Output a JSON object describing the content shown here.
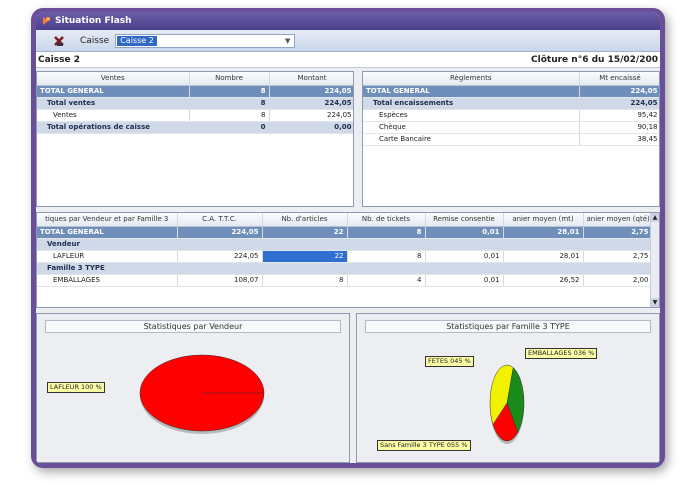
{
  "window": {
    "title": "Situation Flash"
  },
  "toolbar": {
    "caisse_label": "Caisse",
    "caisse_value": "Caisse 2"
  },
  "info": {
    "left": "Caisse 2",
    "right": "Clôture n°6 du 15/02/200"
  },
  "ventes": {
    "headers": [
      "Ventes",
      "Nombre",
      "Montant"
    ],
    "rows": [
      {
        "label": "TOTAL GENERAL",
        "nombre": "8",
        "montant": "224,05"
      },
      {
        "label": "Total ventes",
        "nombre": "8",
        "montant": "224,05"
      },
      {
        "label": "Ventes",
        "nombre": "8",
        "montant": "224,05"
      },
      {
        "label": "Total opérations de caisse",
        "nombre": "0",
        "montant": "0,00"
      }
    ]
  },
  "reglements": {
    "headers": [
      "Règlements",
      "Mt encaissé"
    ],
    "rows": [
      {
        "label": "TOTAL GENERAL",
        "montant": "224,05"
      },
      {
        "label": "Total encaissements",
        "montant": "224,05"
      },
      {
        "label": "Espèces",
        "montant": "95,42"
      },
      {
        "label": "Chèque",
        "montant": "90,18"
      },
      {
        "label": "Carte Bancaire",
        "montant": "38,45"
      }
    ]
  },
  "stats": {
    "headers": [
      "tiques par Vendeur et par Famille 3",
      "C.A. T.T.C.",
      "Nb. d'articles",
      "Nb. de tickets",
      "Remise consentie",
      "anier moyen (mt)",
      "anier moyen (qté)"
    ],
    "total": [
      "TOTAL GENERAL",
      "224,05",
      "22",
      "8",
      "0,01",
      "28,01",
      "2,75"
    ],
    "group1": "Vendeur",
    "row1": [
      "LAFLEUR",
      "224,05",
      "22",
      "8",
      "0,01",
      "28,01",
      "2,75"
    ],
    "group2": "Famille 3 TYPE",
    "row2": [
      "EMBALLAGES",
      "108,07",
      "8",
      "4",
      "0,01",
      "26,52",
      "2,00"
    ]
  },
  "chart_vendeur": {
    "title": "Statistiques par Vendeur",
    "label": "LAFLEUR 100 %"
  },
  "chart_famille": {
    "title": "Statistiques par Famille 3 TYPE",
    "labels": [
      "FETES 045 %",
      "EMBALLAGES 036 %",
      "Sans Famille 3 TYPE 055 %"
    ]
  },
  "chart_data": [
    {
      "type": "pie",
      "title": "Statistiques par Vendeur",
      "categories": [
        "LAFLEUR"
      ],
      "values": [
        100
      ],
      "colors": [
        "#ff0000"
      ]
    },
    {
      "type": "pie",
      "title": "Statistiques par Famille 3 TYPE",
      "categories": [
        "FETES",
        "EMBALLAGES",
        "Sans Famille 3 TYPE"
      ],
      "values": [
        45,
        36,
        55
      ],
      "colors": [
        "#1a8a1a",
        "#ff0000",
        "#f2f200"
      ]
    }
  ],
  "colors": {
    "accent": "#6a4e9a",
    "total_row": "#6f8fba",
    "group_row": "#cfd9e8",
    "selection": "#2f6fd0"
  }
}
